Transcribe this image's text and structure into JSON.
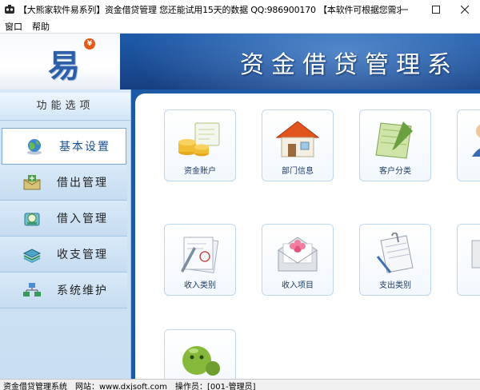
{
  "window": {
    "title": "【大熊家软件易系列】资金借贷管理    您还能试用15天的数据    QQ:986900170   【本软件可根据您需求进行个..."
  },
  "menu": {
    "items": [
      "窗口",
      "帮助"
    ]
  },
  "banner": {
    "logo_char": "易",
    "logo_badge": "¥",
    "title": "资金借贷管理系"
  },
  "sidebar": {
    "heading": "功能选项",
    "items": [
      {
        "label": "基本设置",
        "icon": "globe-icon"
      },
      {
        "label": "借出管理",
        "icon": "envelope-out-icon"
      },
      {
        "label": "借入管理",
        "icon": "box-in-icon"
      },
      {
        "label": "收支管理",
        "icon": "books-icon"
      },
      {
        "label": "系统维护",
        "icon": "network-icon"
      }
    ],
    "active_index": 0
  },
  "tiles": [
    {
      "label": "资金账户",
      "icon": "coins-icon"
    },
    {
      "label": "部门信息",
      "icon": "house-icon"
    },
    {
      "label": "客户分类",
      "icon": "notepad-icon"
    },
    {
      "label": "",
      "icon": "person-icon"
    },
    {
      "label": "收入类别",
      "icon": "certificate-icon"
    },
    {
      "label": "收入项目",
      "icon": "letter-flower-icon"
    },
    {
      "label": "支出类别",
      "icon": "clipboard-icon"
    },
    {
      "label": "",
      "icon": "partial-icon"
    },
    {
      "label": "",
      "icon": "green-character-icon"
    }
  ],
  "status": {
    "app": "资金借贷管理系统",
    "website": "网站：www.dxjsoft.com",
    "operator": "操作员：[001-管理员]"
  },
  "colors": {
    "banner": "#1b4e98",
    "panel": "#c8def2",
    "accent": "#1c5aa6"
  }
}
